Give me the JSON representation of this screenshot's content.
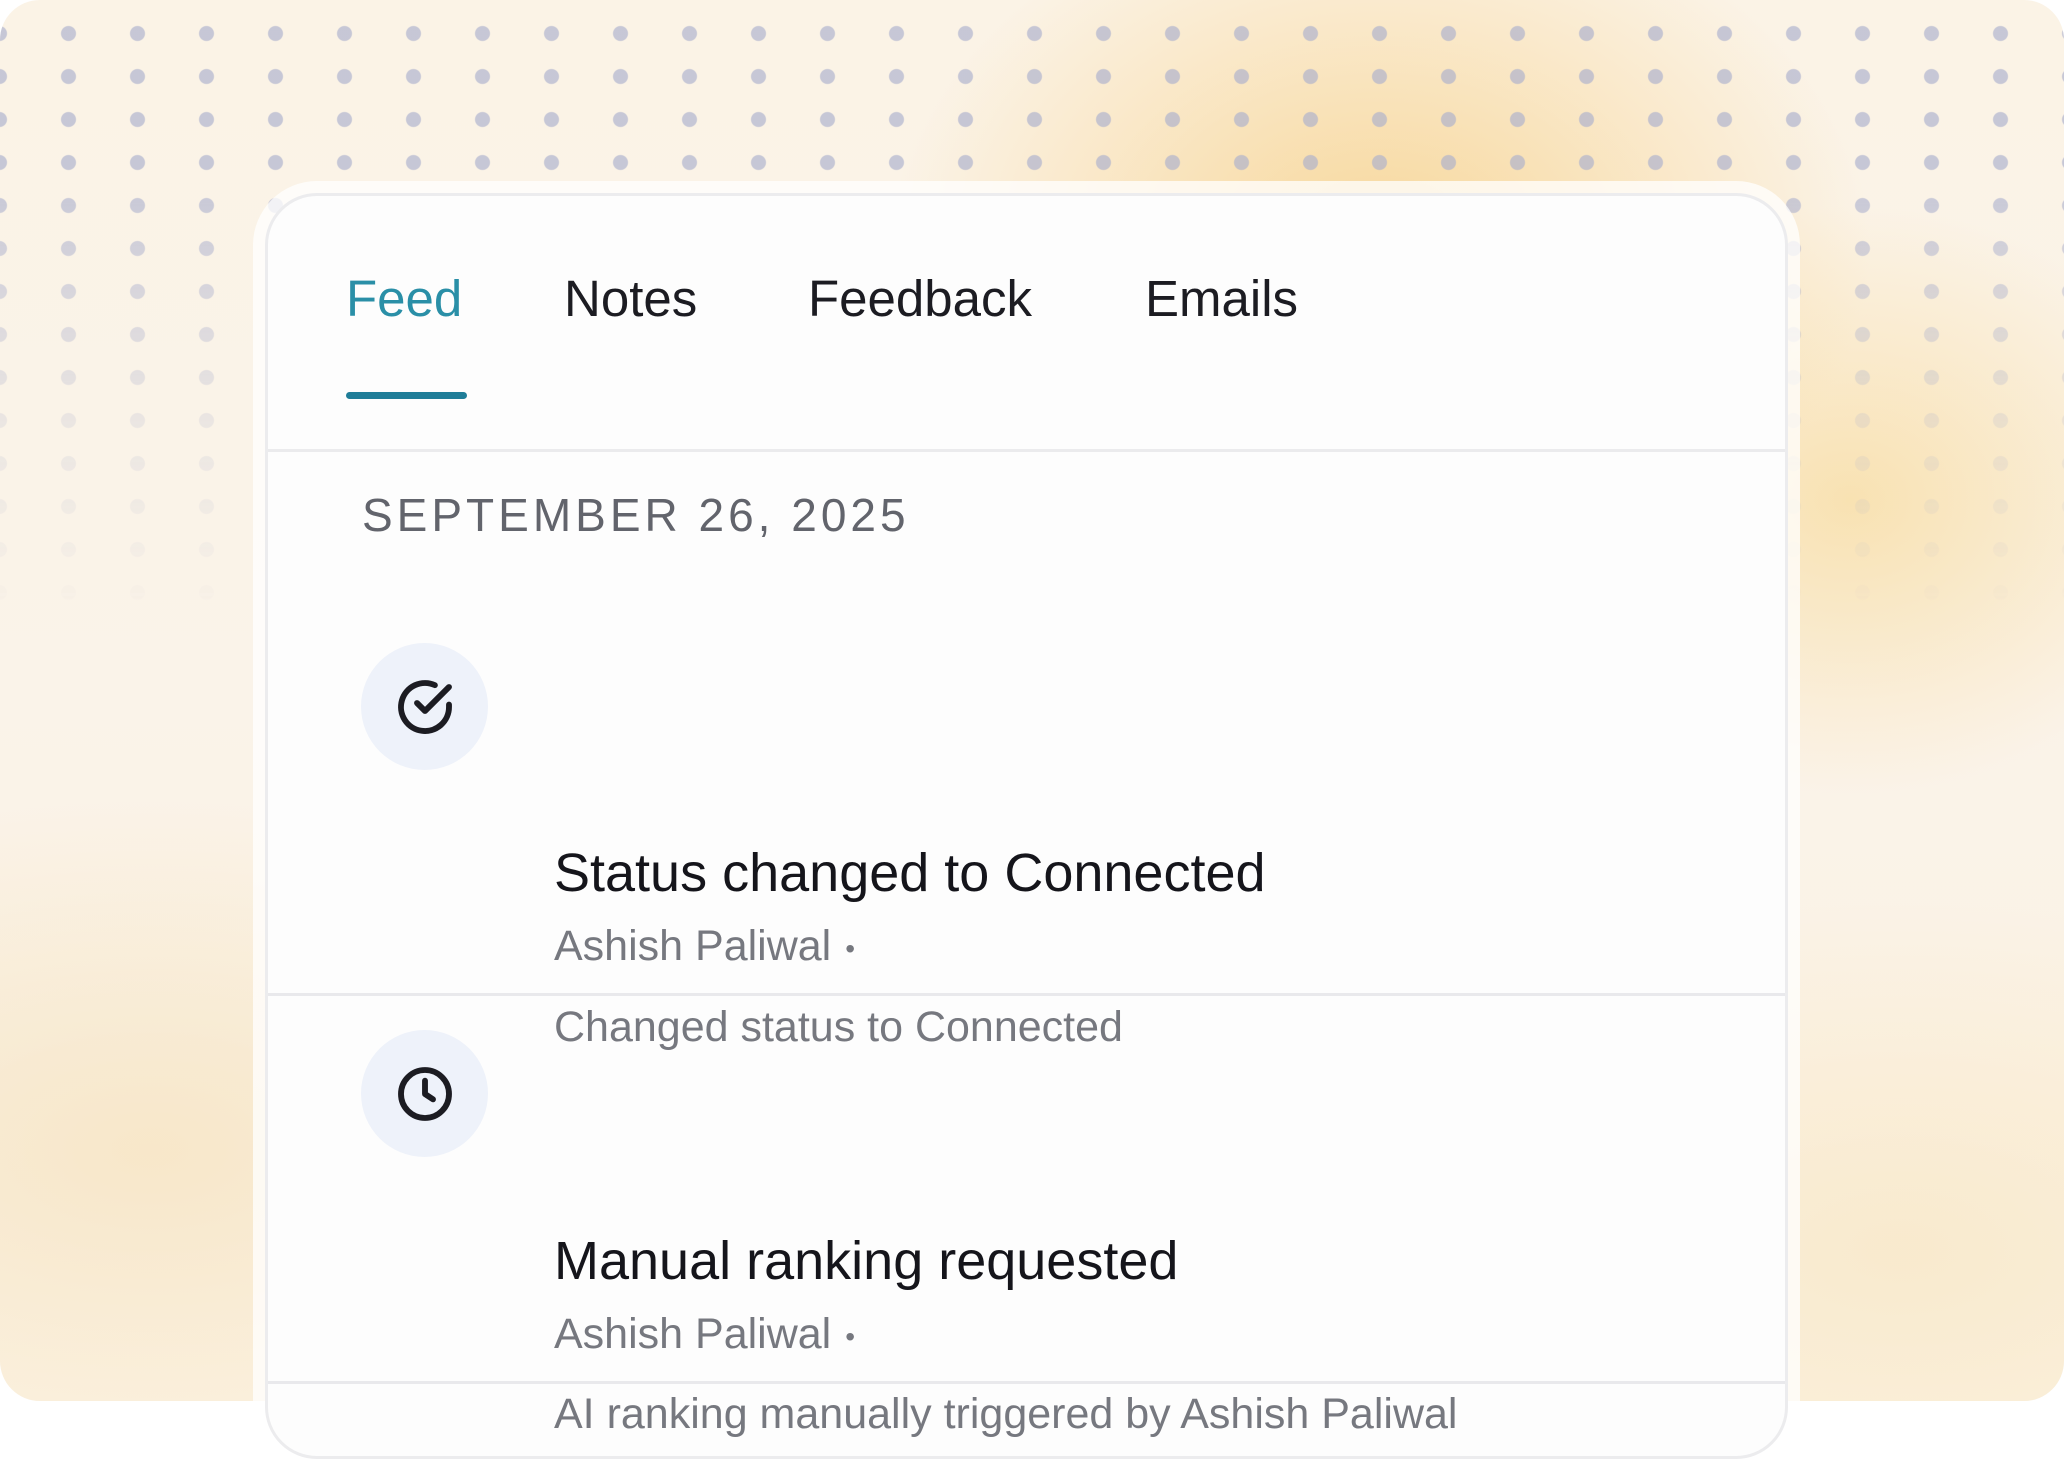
{
  "tabs": [
    {
      "label": "Feed",
      "active": true
    },
    {
      "label": "Notes",
      "active": false
    },
    {
      "label": "Feedback",
      "active": false
    },
    {
      "label": "Emails",
      "active": false
    }
  ],
  "feed": {
    "date_header": "SEPTEMBER 26, 2025",
    "items": [
      {
        "icon": "check-circle-icon",
        "title": "Status changed to Connected",
        "author": "Ashish Paliwal",
        "separator": "•",
        "description": "Changed status to Connected"
      },
      {
        "icon": "clock-icon",
        "title": "Manual ranking requested",
        "author": "Ashish Paliwal",
        "separator": "•",
        "description": "AI ranking manually triggered by Ashish Paliwal"
      }
    ]
  },
  "colors": {
    "accent": "#2a8fa7",
    "accent_underline": "#1f7d98",
    "title_text": "#15151b",
    "muted_text": "#76787f",
    "icon_bg": "#eef2fa"
  }
}
